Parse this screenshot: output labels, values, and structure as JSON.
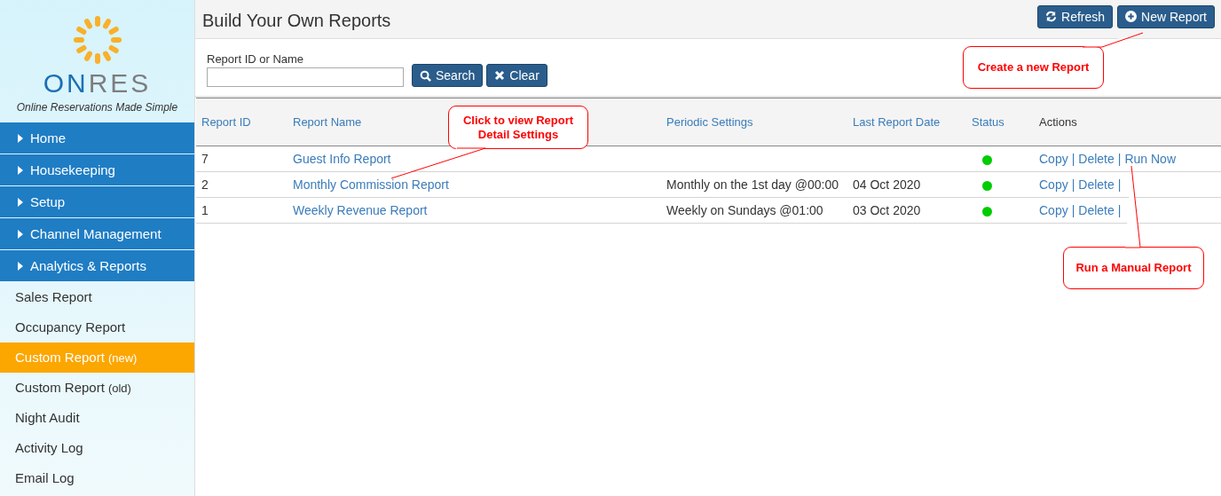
{
  "logo": {
    "first": "ON",
    "second": "RES",
    "tagline": "Online Reservations Made Simple"
  },
  "sidebar": {
    "items": [
      {
        "label": "Home",
        "kind": "section",
        "selected": false
      },
      {
        "label": "Housekeeping",
        "kind": "section",
        "selected": false
      },
      {
        "label": "Setup",
        "kind": "section",
        "selected": false
      },
      {
        "label": "Channel Management",
        "kind": "section",
        "selected": false
      },
      {
        "label": "Analytics & Reports",
        "kind": "section",
        "selected": false
      },
      {
        "label": "Sales Report",
        "kind": "link",
        "selected": false
      },
      {
        "label": "Occupancy Report",
        "kind": "link",
        "selected": false
      },
      {
        "label": "Custom Report",
        "note": "(new)",
        "kind": "link",
        "selected": true
      },
      {
        "label": "Custom Report",
        "note": "(old)",
        "kind": "link",
        "selected": false
      },
      {
        "label": "Night Audit",
        "kind": "link",
        "selected": false
      },
      {
        "label": "Activity Log",
        "kind": "link",
        "selected": false
      },
      {
        "label": "Email Log",
        "kind": "link",
        "selected": false
      }
    ]
  },
  "header": {
    "title": "Build Your Own Reports",
    "buttons": [
      {
        "label": "Refresh",
        "kind": "refresh"
      },
      {
        "label": "New Report",
        "kind": "add"
      }
    ]
  },
  "search": {
    "label": "Report ID or Name",
    "buttons": [
      {
        "label": "Search",
        "kind": "search"
      },
      {
        "label": "Clear",
        "kind": "clear"
      }
    ]
  },
  "table": {
    "columns": [
      {
        "label": "Report ID",
        "sortable": true
      },
      {
        "label": "Report Name",
        "sortable": true
      },
      {
        "label": "Periodic Settings",
        "sortable": true
      },
      {
        "label": "Last Report Date",
        "sortable": true
      },
      {
        "label": "Status",
        "sortable": true
      },
      {
        "label": "Actions",
        "sortable": false
      }
    ],
    "rows": [
      {
        "id": "7",
        "name": "Guest Info Report",
        "color": "#00cc00",
        "actions": [
          {
            "label": "Copy",
            "kind": "link"
          },
          {
            "label": "|",
            "kind": "separator"
          },
          {
            "label": "Delete",
            "kind": "link"
          },
          {
            "label": "|",
            "kind": "separator"
          },
          {
            "label": "Run Now",
            "kind": "link"
          }
        ]
      },
      {
        "id": "2",
        "name": "Monthly Commission Report",
        "periodic": "Monthly on the 1st day @00:00",
        "last_date": "04 Oct 2020",
        "color": "#00cc00",
        "actions": [
          {
            "label": "Copy",
            "kind": "link"
          },
          {
            "label": "|",
            "kind": "separator"
          },
          {
            "label": "Delete",
            "kind": "link"
          },
          {
            "label": "|",
            "kind": "separator"
          }
        ]
      },
      {
        "id": "1",
        "name": "Weekly Revenue Report",
        "periodic": "Weekly on Sundays @01:00",
        "last_date": "03 Oct 2020",
        "color": "#00cc00",
        "actions": [
          {
            "label": "Copy",
            "kind": "link"
          },
          {
            "label": "|",
            "kind": "separator"
          },
          {
            "label": "Delete",
            "kind": "link"
          },
          {
            "label": "|",
            "kind": "separator"
          }
        ]
      }
    ]
  },
  "callouts": [
    {
      "text": "Create a new Report"
    },
    {
      "text": "Click to view Report Detail Settings"
    },
    {
      "text": "Run a Manual Report"
    }
  ]
}
